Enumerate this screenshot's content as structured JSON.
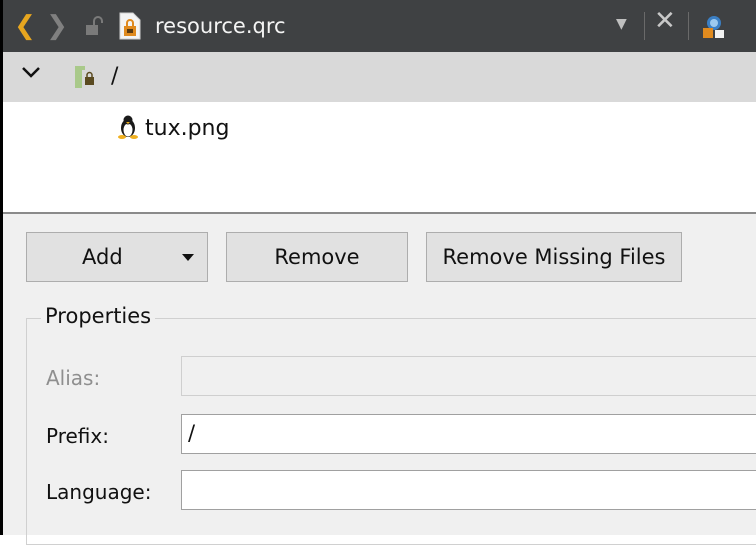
{
  "toolbar": {
    "filename": "resource.qrc",
    "colors": {
      "background": "#3f4143",
      "back_arrow": "#e7a61f"
    }
  },
  "tree": {
    "root_label": "/",
    "child_label": "tux.png"
  },
  "buttons": {
    "add": "Add",
    "remove": "Remove",
    "remove_missing": "Remove Missing Files"
  },
  "properties": {
    "title": "Properties",
    "alias": {
      "label": "Alias:",
      "value": ""
    },
    "prefix": {
      "label": "Prefix:",
      "value": "/"
    },
    "language": {
      "label": "Language:",
      "value": ""
    }
  }
}
